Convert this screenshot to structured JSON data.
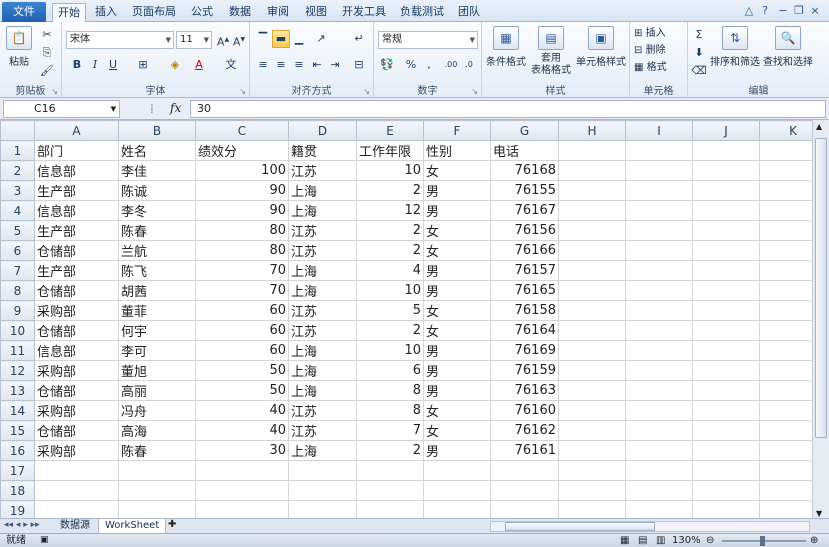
{
  "tabs": [
    "文件",
    "开始",
    "插入",
    "页面布局",
    "公式",
    "数据",
    "审阅",
    "视图",
    "开发工具",
    "负载测试",
    "团队"
  ],
  "ribbon": {
    "clipboard": {
      "paste": "粘贴",
      "label": "剪贴板"
    },
    "font": {
      "name": "宋体",
      "size": "11",
      "label": "字体"
    },
    "align": {
      "label": "对齐方式"
    },
    "number": {
      "format": "常规",
      "label": "数字"
    },
    "styles": {
      "cond": "条件格式",
      "table": "套用\n表格格式",
      "cell": "单元格样式",
      "label": "样式"
    },
    "cells": {
      "insert": "插入",
      "delete": "删除",
      "format": "格式",
      "label": "单元格"
    },
    "editing": {
      "sort": "排序和筛选",
      "find": "查找和选择",
      "label": "编辑"
    }
  },
  "formula": {
    "cell": "C16",
    "fx": "fx",
    "value": "30"
  },
  "columns": [
    "A",
    "B",
    "C",
    "D",
    "E",
    "F",
    "G",
    "H",
    "I",
    "J",
    "K"
  ],
  "rows": [
    [
      "部门",
      "姓名",
      "绩效分",
      "籍贯",
      "工作年限",
      "性别",
      "电话"
    ],
    [
      "信息部",
      "李佳",
      "100",
      "江苏",
      "10",
      "女",
      "76168"
    ],
    [
      "生产部",
      "陈诚",
      "90",
      "上海",
      "2",
      "男",
      "76155"
    ],
    [
      "信息部",
      "李冬",
      "90",
      "上海",
      "12",
      "男",
      "76167"
    ],
    [
      "生产部",
      "陈春",
      "80",
      "江苏",
      "2",
      "女",
      "76156"
    ],
    [
      "仓储部",
      "兰航",
      "80",
      "江苏",
      "2",
      "女",
      "76166"
    ],
    [
      "生产部",
      "陈飞",
      "70",
      "上海",
      "4",
      "男",
      "76157"
    ],
    [
      "仓储部",
      "胡茜",
      "70",
      "上海",
      "10",
      "男",
      "76165"
    ],
    [
      "采购部",
      "董菲",
      "60",
      "江苏",
      "5",
      "女",
      "76158"
    ],
    [
      "仓储部",
      "何宇",
      "60",
      "江苏",
      "2",
      "女",
      "76164"
    ],
    [
      "信息部",
      "李可",
      "60",
      "上海",
      "10",
      "男",
      "76169"
    ],
    [
      "采购部",
      "董旭",
      "50",
      "上海",
      "6",
      "男",
      "76159"
    ],
    [
      "仓储部",
      "高丽",
      "50",
      "上海",
      "8",
      "男",
      "76163"
    ],
    [
      "采购部",
      "冯舟",
      "40",
      "江苏",
      "8",
      "女",
      "76160"
    ],
    [
      "仓储部",
      "高海",
      "40",
      "江苏",
      "7",
      "女",
      "76162"
    ],
    [
      "采购部",
      "陈春",
      "30",
      "上海",
      "2",
      "男",
      "76161"
    ],
    [],
    [],
    []
  ],
  "sheets": [
    "数据源",
    "WorkSheet"
  ],
  "status": {
    "mode": "就绪",
    "zoom": "130%"
  }
}
